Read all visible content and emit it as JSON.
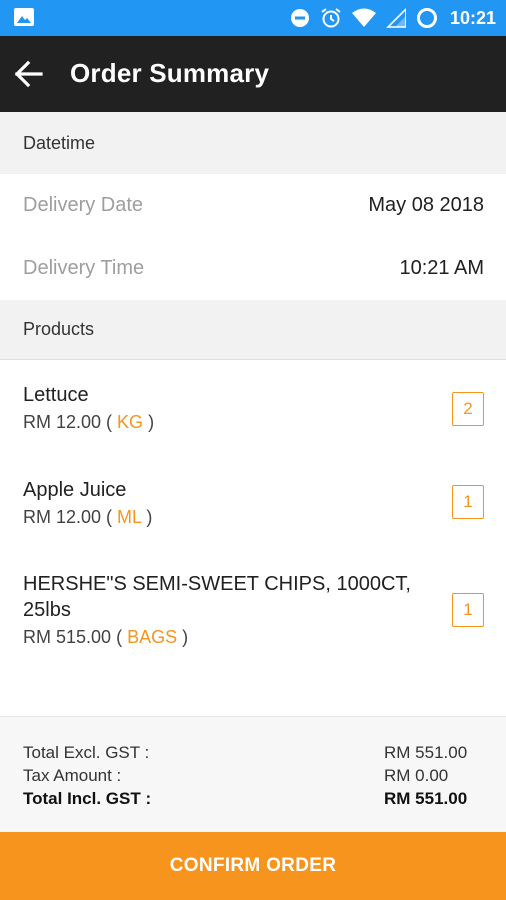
{
  "status_bar": {
    "time": "10:21",
    "icons": [
      "image-icon",
      "do-not-disturb-icon",
      "alarm-icon",
      "wifi-icon",
      "signal-icon",
      "battery-icon"
    ]
  },
  "app_bar": {
    "title": "Order Summary",
    "back_icon": "arrow-back-icon"
  },
  "datetime": {
    "header": "Datetime",
    "delivery_date_label": "Delivery Date",
    "delivery_date_value": "May 08 2018",
    "delivery_time_label": "Delivery Time",
    "delivery_time_value": "10:21 AM"
  },
  "products": {
    "header": "Products",
    "items": [
      {
        "name": "Lettuce",
        "price": "RM 12.00",
        "unit": "KG",
        "qty": "2"
      },
      {
        "name": "Apple Juice",
        "price": "RM 12.00",
        "unit": "ML",
        "qty": "1"
      },
      {
        "name": "HERSHE\"S SEMI-SWEET CHIPS, 1000CT, 25lbs",
        "price": "RM 515.00",
        "unit": "BAGS",
        "qty": "1"
      }
    ]
  },
  "totals": {
    "excl_label": "Total Excl. GST :",
    "excl_value": "RM 551.00",
    "tax_label": "Tax Amount :",
    "tax_value": "RM 0.00",
    "incl_label": "Total Incl. GST :",
    "incl_value": "RM 551.00"
  },
  "confirm_label": "CONFIRM ORDER",
  "colors": {
    "status_bar": "#2196f3",
    "app_bar": "#212121",
    "accent": "#f7941d"
  }
}
